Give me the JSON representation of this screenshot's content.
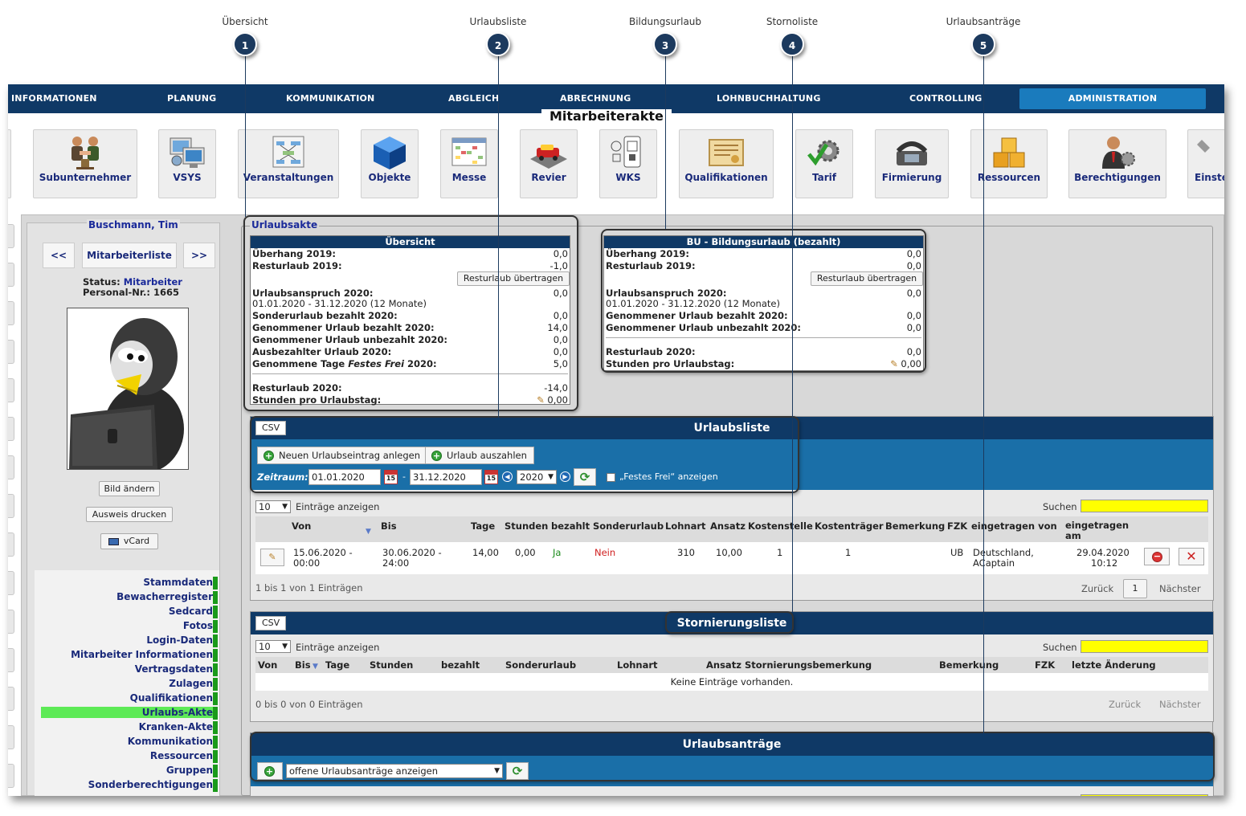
{
  "callouts": [
    {
      "num": "1",
      "label": "Übersicht"
    },
    {
      "num": "2",
      "label": "Urlaubsliste"
    },
    {
      "num": "3",
      "label": "Bildungsurlaub"
    },
    {
      "num": "4",
      "label": "Stornoliste"
    },
    {
      "num": "5",
      "label": "Urlaubsanträge"
    }
  ],
  "nav": {
    "items": [
      "INFORMATIONEN",
      "PLANUNG",
      "KOMMUNIKATION",
      "ABGLEICH",
      "ABRECHNUNG",
      "LOHNBUCHHALTUNG",
      "CONTROLLING",
      "ADMINISTRATION"
    ],
    "active": "ADMINISTRATION"
  },
  "page_title": "Mitarbeiterakte",
  "toolbar": [
    {
      "label": "Subunternehmer",
      "icon": "handshake-icon"
    },
    {
      "label": "VSYS",
      "icon": "computers-icon"
    },
    {
      "label": "Veranstaltungen",
      "icon": "diagram-icon"
    },
    {
      "label": "Objekte",
      "icon": "cube-icon"
    },
    {
      "label": "Messe",
      "icon": "calendar-grid-icon"
    },
    {
      "label": "Revier",
      "icon": "car-map-icon"
    },
    {
      "label": "WKS",
      "icon": "phone-qr-icon"
    },
    {
      "label": "Qualifikationen",
      "icon": "certificate-icon"
    },
    {
      "label": "Tarif",
      "icon": "gear-check-icon"
    },
    {
      "label": "Firmierung",
      "icon": "telephone-icon"
    },
    {
      "label": "Ressourcen",
      "icon": "boxes-icon"
    },
    {
      "label": "Berechtigungen",
      "icon": "user-gear-icon"
    },
    {
      "label": "Einste",
      "icon": "wrench-icon"
    }
  ],
  "employee": {
    "name": "Buschmann, Tim",
    "prev": "<<",
    "list": "Mitarbeiterliste",
    "next": ">>",
    "status_label": "Status:",
    "status_value": "Mitarbeiter",
    "personal_nr_label": "Personal-Nr.:",
    "personal_nr": "1665",
    "btn_change_image": "Bild ändern",
    "btn_print_id": "Ausweis drucken",
    "btn_vcard": "vCard"
  },
  "menu": [
    "Stammdaten",
    "Bewacherregister",
    "Sedcard",
    "Fotos",
    "Login-Daten",
    "Mitarbeiter Informationen",
    "Vertragsdaten",
    "Zulagen",
    "Qualifikationen",
    "Urlaubs-Akte",
    "Kranken-Akte",
    "Kommunikation",
    "Ressourcen",
    "Gruppen",
    "Sonderberechtigungen"
  ],
  "menu_active": "Urlaubs-Akte",
  "urlaubsakte": {
    "legend": "Urlaubsakte",
    "overview": {
      "header": "Übersicht",
      "rows": [
        {
          "label": "Überhang 2019:",
          "value": "0,0"
        },
        {
          "label": "Resturlaub 2019:",
          "value": "-1,0"
        },
        {
          "label": "Urlaubsanspruch 2020:",
          "value": "0,0"
        },
        {
          "label": "01.01.2020 - 31.12.2020 (12 Monate)",
          "value": ""
        },
        {
          "label": "Sonderurlaub bezahlt 2020:",
          "value": "0,0"
        },
        {
          "label": "Genommener Urlaub bezahlt 2020:",
          "value": "14,0"
        },
        {
          "label": "Genommener Urlaub unbezahlt 2020:",
          "value": "0,0"
        },
        {
          "label": "Ausbezahlter Urlaub 2020:",
          "value": "0,0"
        },
        {
          "label": "Genommene Tage ",
          "label_italic": "Festes Frei",
          "label_suffix": " 2020:",
          "value": "5,0"
        },
        {
          "label": "Resturlaub 2020:",
          "value": "-14,0"
        },
        {
          "label": "Stunden pro Urlaubstag:",
          "value": "0,00"
        }
      ],
      "transfer_btn": "Resturlaub übertragen"
    },
    "bu": {
      "header": "BU - Bildungsurlaub (bezahlt)",
      "rows": [
        {
          "label": "Überhang 2019:",
          "value": "0,0"
        },
        {
          "label": "Resturlaub 2019:",
          "value": "0,0"
        },
        {
          "label": "Urlaubsanspruch 2020:",
          "value": "0,0"
        },
        {
          "label": "01.01.2020 - 31.12.2020 (12 Monate)",
          "value": ""
        },
        {
          "label": "Genommener Urlaub bezahlt 2020:",
          "value": "0,0"
        },
        {
          "label": "Genommener Urlaub unbezahlt 2020:",
          "value": "0,0"
        },
        {
          "label": "Resturlaub 2020:",
          "value": "0,0"
        },
        {
          "label": "Stunden pro Urlaubstag:",
          "value": "0,00"
        }
      ],
      "transfer_btn": "Resturlaub übertragen"
    }
  },
  "urlaubsliste": {
    "title": "Urlaubsliste",
    "csv": "CSV",
    "btn_new": "Neuen Urlaubseintrag anlegen",
    "btn_payout": "Urlaub auszahlen",
    "zeitraum_label": "Zeitraum:",
    "date_from": "01.01.2020",
    "date_sep": "-",
    "date_to": "31.12.2020",
    "cal_day": "15",
    "year": "2020",
    "festes_frei": "„Festes Frei“ anzeigen",
    "entries_value": "10",
    "entries_label": "Einträge anzeigen",
    "search_label": "Suchen",
    "columns": [
      "Von",
      "Bis",
      "Tage",
      "Stunden",
      "bezahlt",
      "Sonderurlaub",
      "Lohnart",
      "Ansatz",
      "Kostenstelle",
      "Kostenträger",
      "Bemerkung",
      "FZK",
      "eingetragen von",
      "eingetragen am"
    ],
    "rows": [
      {
        "von": "15.06.2020 -",
        "von2": "00:00",
        "bis": "30.06.2020 -",
        "bis2": "24:00",
        "tage": "14,00",
        "stunden": "0,00",
        "bezahlt": "Ja",
        "sonderurlaub": "Nein",
        "lohnart": "310",
        "ansatz": "10,00",
        "kostenstelle": "1",
        "kostentraeger": "1",
        "bemerkung": "",
        "fzk": "UB",
        "von_user": "Deutschland,",
        "von_user2": "ACaptain",
        "am": "29.04.2020",
        "am2": "10:12"
      }
    ],
    "info": "1 bis 1 von 1 Einträgen",
    "prev": "Zurück",
    "page": "1",
    "next": "Nächster"
  },
  "stornoliste": {
    "title": "Stornierungsliste",
    "csv": "CSV",
    "entries_value": "10",
    "entries_label": "Einträge anzeigen",
    "search_label": "Suchen",
    "columns": [
      "Von",
      "Bis",
      "Tage",
      "Stunden",
      "bezahlt",
      "Sonderurlaub",
      "Lohnart",
      "Ansatz",
      "Stornierungsbemerkung",
      "Bemerkung",
      "FZK",
      "letzte Änderung"
    ],
    "empty": "Keine Einträge vorhanden.",
    "info": "0 bis 0 von 0 Einträgen",
    "prev": "Zurück",
    "next": "Nächster"
  },
  "antraege": {
    "title": "Urlaubsanträge",
    "filter": "offene Urlaubsanträge anzeigen"
  },
  "colors": {
    "nav_bg": "#0f3966",
    "nav_active": "#1a7bbd",
    "blue_bar": "#1a6fa8",
    "search_bg": "#ffff00",
    "menu_active": "#5dea56",
    "yes": "#1a8a1a",
    "no": "#d02020"
  }
}
